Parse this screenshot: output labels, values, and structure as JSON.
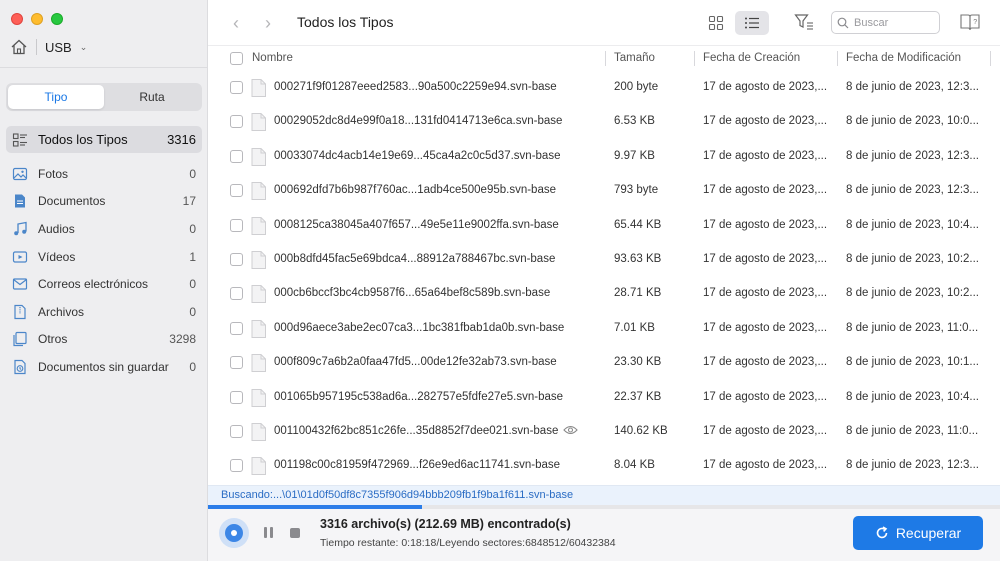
{
  "window": {
    "title": "Todos los Tipos"
  },
  "device": {
    "name": "USB"
  },
  "sidebar": {
    "tabs": [
      {
        "label": "Tipo",
        "active": true
      },
      {
        "label": "Ruta",
        "active": false
      }
    ],
    "categories": [
      {
        "label": "Todos los Tipos",
        "count": "3316",
        "icon": "all-types-icon"
      },
      {
        "label": "Fotos",
        "count": "0",
        "icon": "photo-icon"
      },
      {
        "label": "Documentos",
        "count": "17",
        "icon": "document-icon"
      },
      {
        "label": "Audios",
        "count": "0",
        "icon": "music-note-icon"
      },
      {
        "label": "Vídeos",
        "count": "1",
        "icon": "video-icon"
      },
      {
        "label": "Correos electrónicos",
        "count": "0",
        "icon": "mail-icon"
      },
      {
        "label": "Archivos",
        "count": "0",
        "icon": "archive-icon"
      },
      {
        "label": "Otros",
        "count": "3298",
        "icon": "other-files-icon"
      },
      {
        "label": "Documentos sin guardar",
        "count": "0",
        "icon": "unsaved-document-icon"
      }
    ]
  },
  "toolbar": {
    "search_placeholder": "Buscar"
  },
  "table": {
    "headers": {
      "name": "Nombre",
      "size": "Tamaño",
      "created": "Fecha de Creación",
      "modified": "Fecha de Modificación"
    },
    "rows": [
      {
        "name": "000271f9f01287eeed2583...90a500c2259e94.svn-base",
        "size": "200 byte",
        "created": "17 de agosto de 2023,...",
        "modified": "8 de junio de 2023, 12:3..."
      },
      {
        "name": "00029052dc8d4e99f0a18...131fd0414713e6ca.svn-base",
        "size": "6.53 KB",
        "created": "17 de agosto de 2023,...",
        "modified": "8 de junio de 2023, 10:0..."
      },
      {
        "name": "00033074dc4acb14e19e69...45ca4a2c0c5d37.svn-base",
        "size": "9.97 KB",
        "created": "17 de agosto de 2023,...",
        "modified": "8 de junio de 2023, 12:3..."
      },
      {
        "name": "000692dfd7b6b987f760ac...1adb4ce500e95b.svn-base",
        "size": "793 byte",
        "created": "17 de agosto de 2023,...",
        "modified": "8 de junio de 2023, 12:3..."
      },
      {
        "name": "0008125ca38045a407f657...49e5e11e9002ffa.svn-base",
        "size": "65.44 KB",
        "created": "17 de agosto de 2023,...",
        "modified": "8 de junio de 2023, 10:4..."
      },
      {
        "name": "000b8dfd45fac5e69bdca4...88912a788467bc.svn-base",
        "size": "93.63 KB",
        "created": "17 de agosto de 2023,...",
        "modified": "8 de junio de 2023, 10:2..."
      },
      {
        "name": "000cb6bccf3bc4cb9587f6...65a64bef8c589b.svn-base",
        "size": "28.71 KB",
        "created": "17 de agosto de 2023,...",
        "modified": "8 de junio de 2023, 10:2..."
      },
      {
        "name": "000d96aece3abe2ec07ca3...1bc381fbab1da0b.svn-base",
        "size": "7.01 KB",
        "created": "17 de agosto de 2023,...",
        "modified": "8 de junio de 2023, 11:0..."
      },
      {
        "name": "000f809c7a6b2a0faa47fd5...00de12fe32ab73.svn-base",
        "size": "23.30 KB",
        "created": "17 de agosto de 2023,...",
        "modified": "8 de junio de 2023, 10:1..."
      },
      {
        "name": "001065b957195c538ad6a...282757e5fdfe27e5.svn-base",
        "size": "22.37 KB",
        "created": "17 de agosto de 2023,...",
        "modified": "8 de junio de 2023, 10:4..."
      },
      {
        "name": "001100432f62bc851c26fe...35d8852f7dee021.svn-base",
        "size": "140.62 KB",
        "created": "17 de agosto de 2023,...",
        "modified": "8 de junio de 2023, 11:0...",
        "preview_icon": "eye-icon"
      },
      {
        "name": "001198c00c81959f472969...f26e9ed6ac11741.svn-base",
        "size": "8.04 KB",
        "created": "17 de agosto de 2023,...",
        "modified": "8 de junio de 2023, 12:3..."
      }
    ]
  },
  "scan": {
    "path_text": "Buscando:...\\01\\01d0f50df8c7355f906d94bbb209fb1f9ba1f611.svn-base",
    "progress_fraction": 0.27
  },
  "footer": {
    "found_text": "3316 archivo(s) (212.69 MB) encontrado(s)",
    "remaining_text": "Tiempo restante: 0:18:18/Leyendo sectores:6848512/60432384",
    "recover_label": "Recuperar"
  },
  "colors": {
    "accent": "#1e7ae6",
    "sidebar_bg": "#eeeef0",
    "scan_text": "#2a6cc4"
  }
}
